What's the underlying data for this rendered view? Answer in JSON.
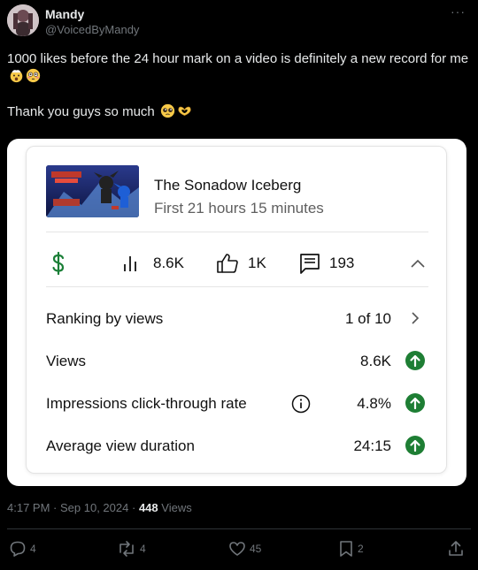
{
  "author": {
    "display_name": "Mandy",
    "handle": "@VoicedByMandy",
    "more_icon": "more-icon"
  },
  "tweet": {
    "line1": "1000 likes before the 24 hour mark on a video is definitely a new record for me",
    "line1_emojis": [
      "exploding-head-emoji",
      "flushed-face-emoji"
    ],
    "line2": "Thank you guys so much",
    "line2_emojis": [
      "pleading-face-emoji",
      "heart-hands-emoji"
    ]
  },
  "analytics_card": {
    "video_title": "The Sonadow Iceberg",
    "video_subtitle": "First 21 hours 15 minutes",
    "thumbnail_text": "SONADOW ICEBERG",
    "stats": {
      "views": "8.6K",
      "likes": "1K",
      "comments": "193"
    },
    "rows": [
      {
        "label": "Ranking by views",
        "value": "1 of 10",
        "indicator": "chevron-right-icon"
      },
      {
        "label": "Views",
        "value": "8.6K",
        "indicator": "arrow-up-icon"
      },
      {
        "label": "Impressions click-through rate",
        "value": "4.8%",
        "indicator": "arrow-up-icon",
        "has_info": true
      },
      {
        "label": "Average view duration",
        "value": "24:15",
        "indicator": "arrow-up-icon"
      }
    ],
    "colors": {
      "monetization": "#1a7f37",
      "up_indicator": "#1e7e34"
    }
  },
  "meta": {
    "time": "4:17 PM",
    "date": "Sep 10, 2024",
    "views_count": "448",
    "views_label": "Views"
  },
  "actions": {
    "replies": "4",
    "reposts": "4",
    "likes": "45",
    "bookmarks": "2"
  }
}
